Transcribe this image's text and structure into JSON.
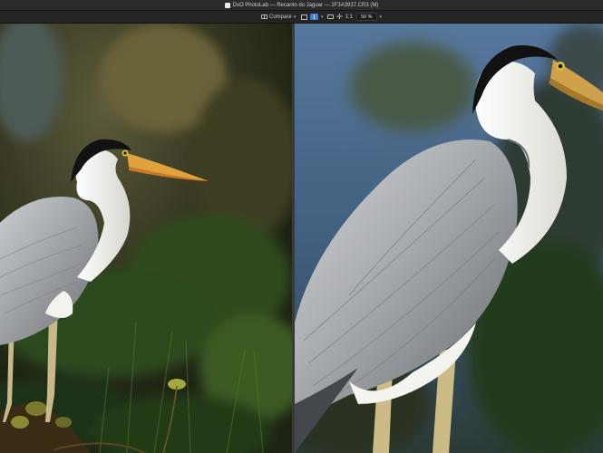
{
  "window": {
    "title": "DxO PhotoLab — Recanto do Jaguar — 2F3A3937.CR3 (M)"
  },
  "toolbar": {
    "compare_label": "Compare",
    "compare_dropdown": "▾",
    "view_dropdown": "▾",
    "zoom_one_to_one": "1:1",
    "zoom_value": "50 %",
    "zoom_dropdown": "▾"
  },
  "icons": {
    "app": "dxo-app-icon",
    "compare": "compare-icon",
    "single_view": "single-view-icon",
    "split_view": "side-by-side-icon",
    "loupe": "loupe-icon",
    "fit": "fit-crosshair-icon"
  },
  "colors": {
    "accent": "#3d7fe0",
    "titlebar": "#2b2b2b",
    "toolbar": "#242424"
  },
  "viewer": {
    "mode": "side-by-side",
    "left_image": "heron-photo-original-wide",
    "right_image": "heron-photo-zoomed"
  }
}
